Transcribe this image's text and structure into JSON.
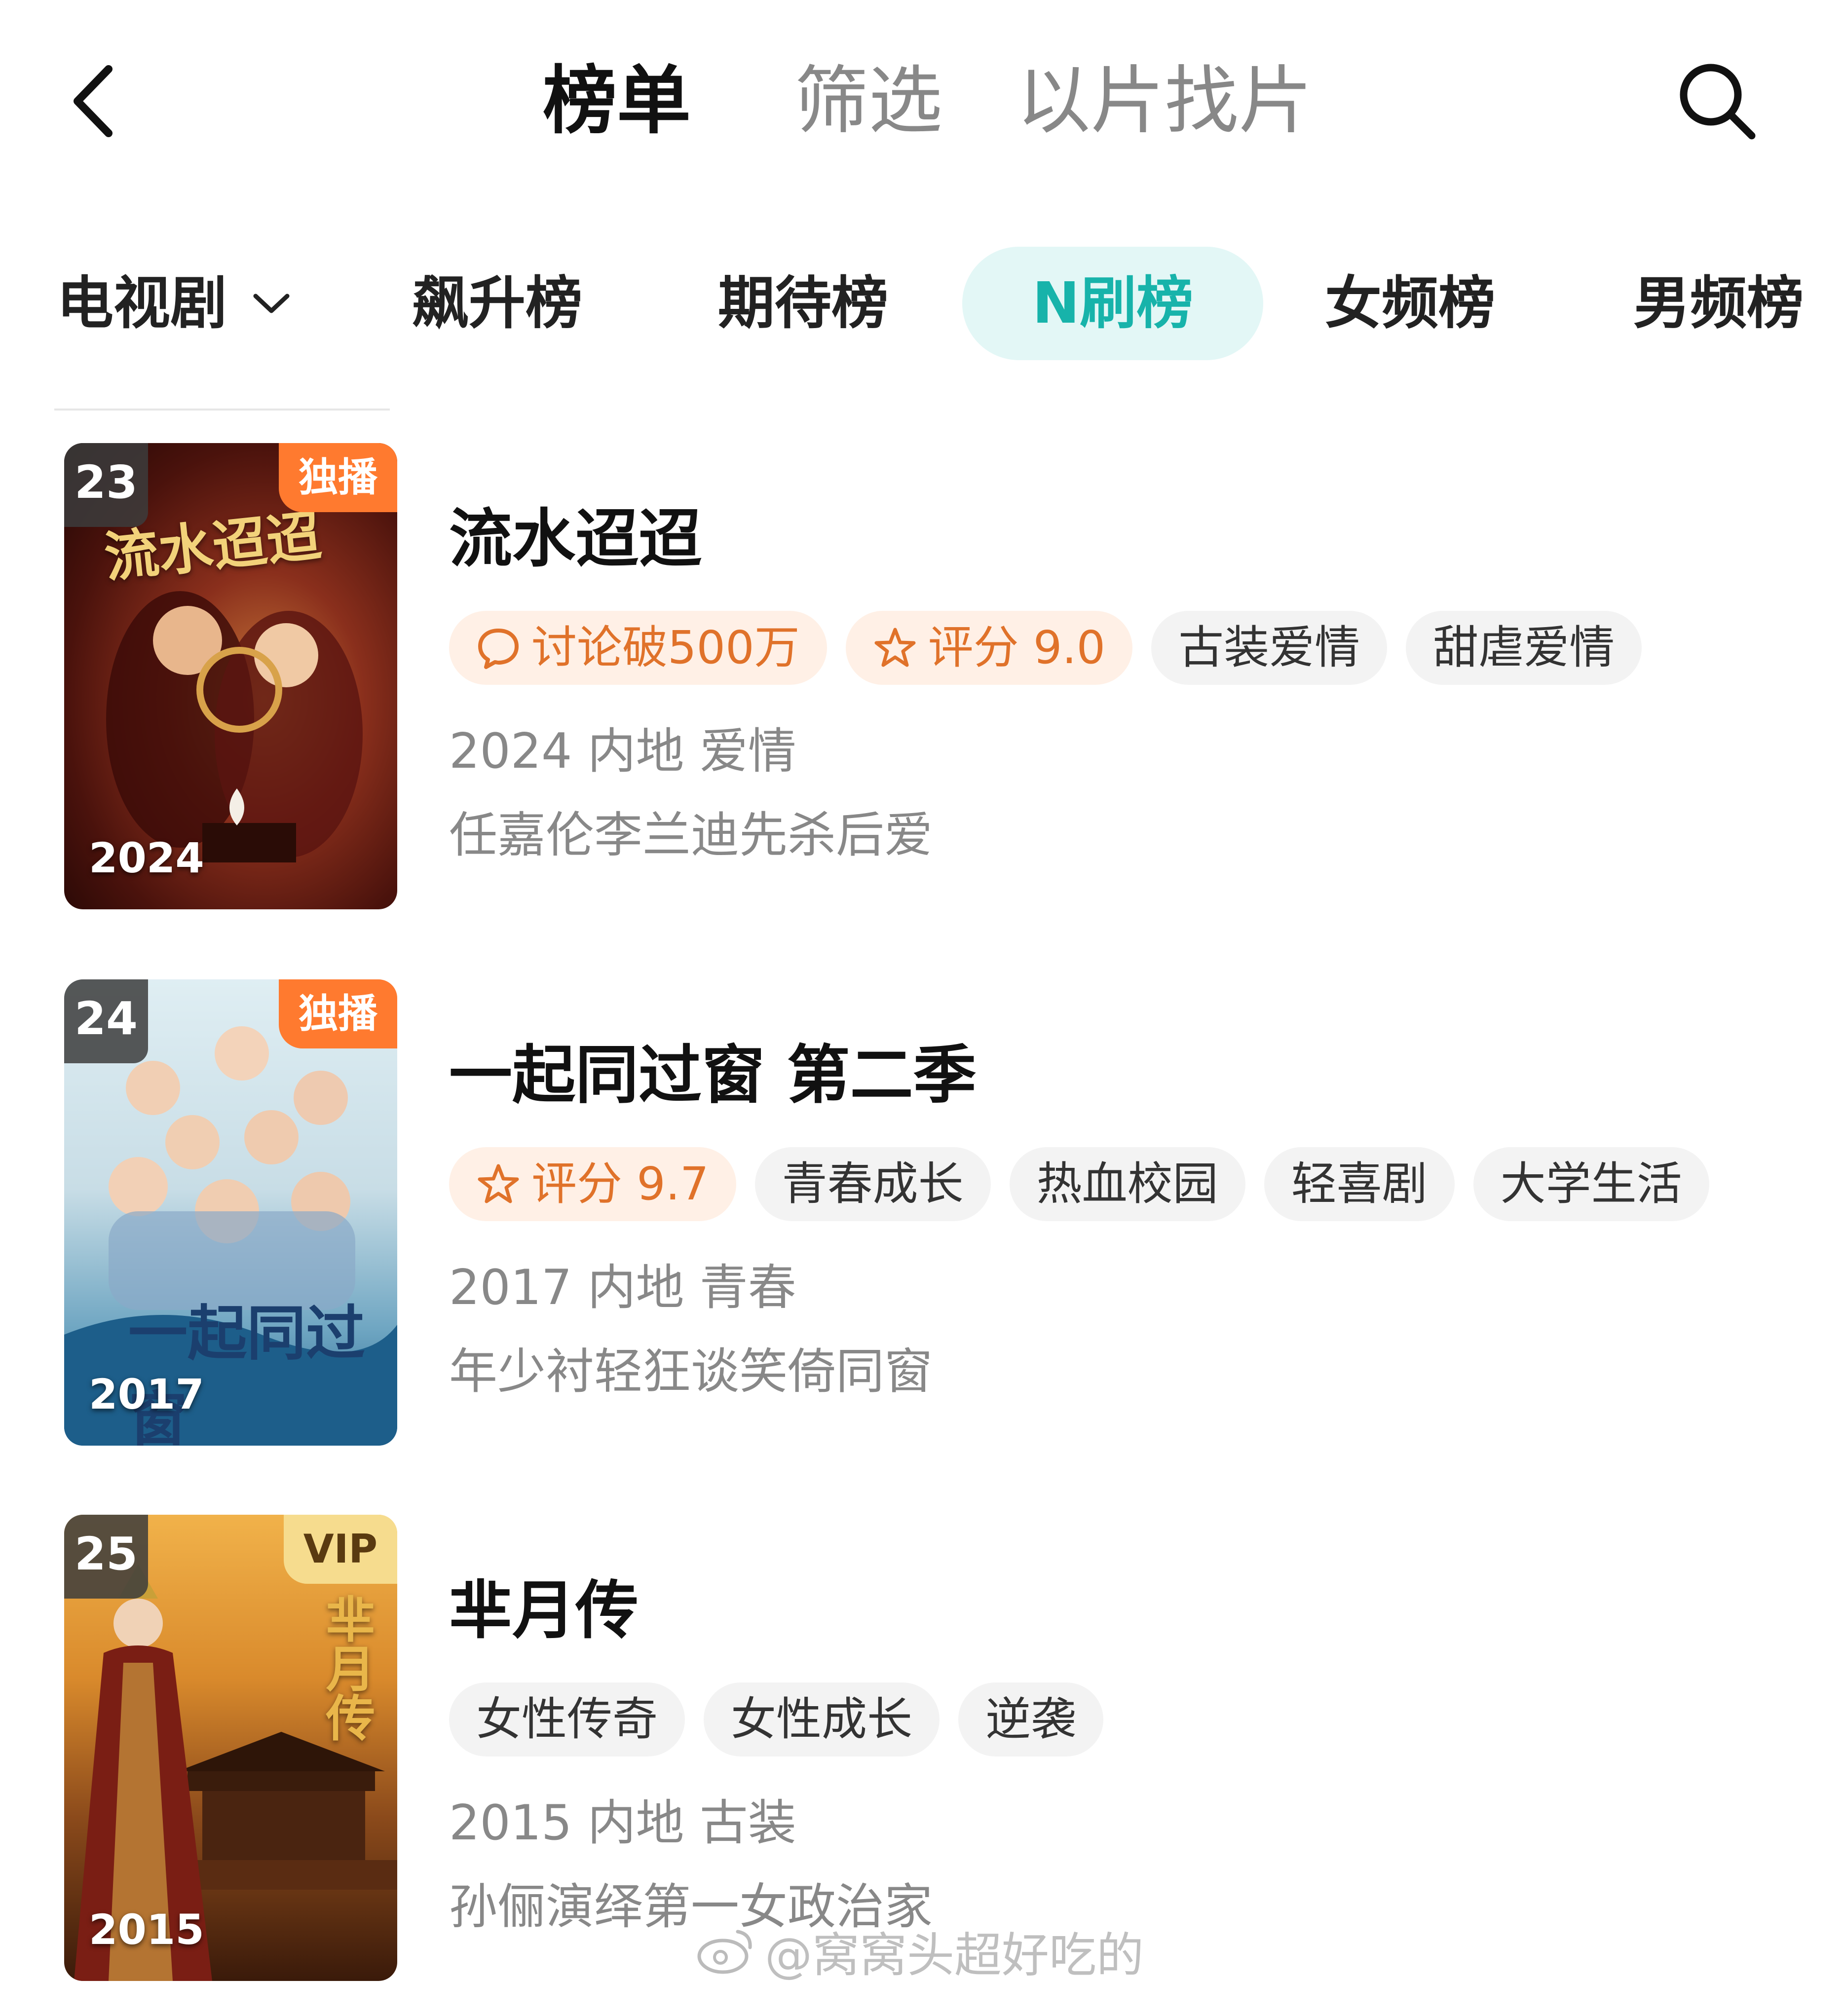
{
  "header": {
    "tabs": [
      {
        "label": "榜单",
        "active": true
      },
      {
        "label": "筛选",
        "active": false
      },
      {
        "label": "以片找片",
        "active": false
      }
    ],
    "back_icon": "chevron-left-icon",
    "search_icon": "search-icon"
  },
  "categories": {
    "dropdown_label": "电视剧",
    "dropdown_icon": "chevron-down-icon",
    "items": [
      {
        "label": "飙升榜",
        "active": false
      },
      {
        "label": "期待榜",
        "active": false
      },
      {
        "label": "N刷榜",
        "active": true
      },
      {
        "label": "女频榜",
        "active": false
      },
      {
        "label": "男频榜",
        "active": false
      }
    ],
    "active_color": "#17b3aa"
  },
  "items": [
    {
      "rank": "23",
      "corner_tag": "独播",
      "poster_year": "2024",
      "title": "流水迢迢",
      "chips": [
        {
          "label": "讨论破500万",
          "hot": true,
          "icon": "chat-bubble-icon"
        },
        {
          "label": "评分 9.0",
          "hot": true,
          "icon": "star-icon"
        },
        {
          "label": "古装爱情",
          "hot": false
        },
        {
          "label": "甜虐爱情",
          "hot": false
        }
      ],
      "meta": "2024 内地 爱情",
      "desc": "任嘉伦李兰迪先杀后爱"
    },
    {
      "rank": "24",
      "corner_tag": "独播",
      "poster_year": "2017",
      "title": "一起同过窗 第二季",
      "chips": [
        {
          "label": "评分 9.7",
          "hot": true,
          "icon": "star-icon"
        },
        {
          "label": "青春成长",
          "hot": false
        },
        {
          "label": "热血校园",
          "hot": false
        },
        {
          "label": "轻喜剧",
          "hot": false
        },
        {
          "label": "大学生活",
          "hot": false
        }
      ],
      "meta": "2017 内地 青春",
      "desc": "年少衬轻狂谈笑倚同窗"
    },
    {
      "rank": "25",
      "corner_tag": "VIP",
      "poster_year": "2015",
      "title": "芈月传",
      "chips": [
        {
          "label": "女性传奇",
          "hot": false
        },
        {
          "label": "女性成长",
          "hot": false
        },
        {
          "label": "逆袭",
          "hot": false
        }
      ],
      "meta": "2015 内地 古装",
      "desc": "孙俪演绎第一女政治家"
    }
  ],
  "watermark": "@窝窝头超好吃的",
  "colors": {
    "accent": "#17b3aa",
    "hot_chip_text": "#e0722a",
    "hot_chip_bg": "#fff0e6",
    "exclusive_tag": "#ff7a2f",
    "vip_tag": "#f6dc8e"
  }
}
